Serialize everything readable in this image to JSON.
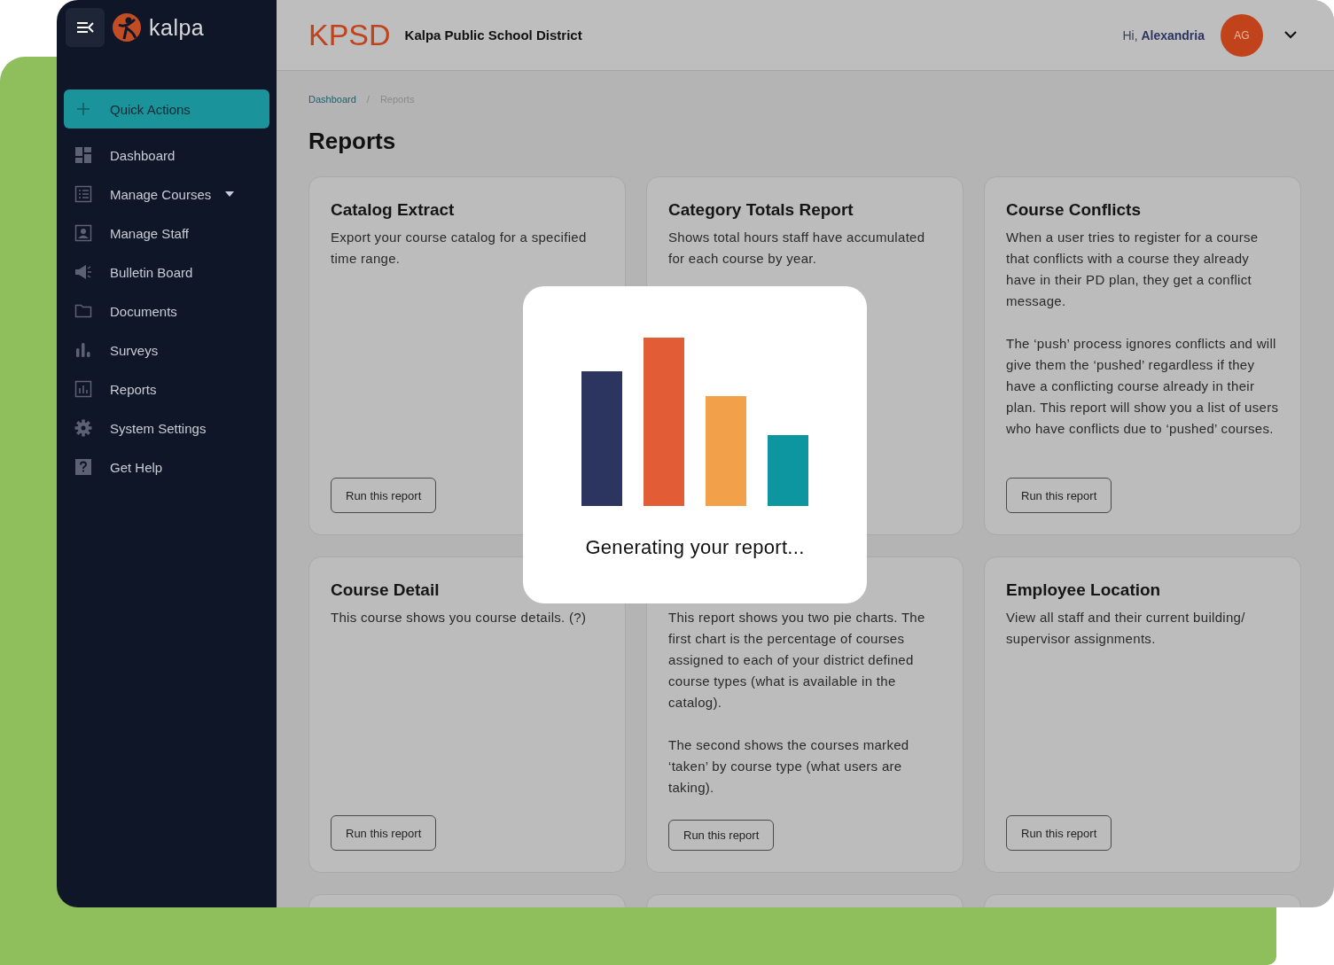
{
  "sidebar": {
    "logo": "kalpa",
    "quick_action": "Quick Actions",
    "items": [
      {
        "label": "Dashboard",
        "kind": "dashboard",
        "expandable": false
      },
      {
        "label": "Manage Courses",
        "kind": "list",
        "expandable": true
      },
      {
        "label": "Manage Staff",
        "kind": "person",
        "expandable": false
      },
      {
        "label": "Bulletin Board",
        "kind": "megaphone",
        "expandable": false
      },
      {
        "label": "Documents",
        "kind": "folder",
        "expandable": false
      },
      {
        "label": "Surveys",
        "kind": "bars",
        "expandable": false
      },
      {
        "label": "Reports",
        "kind": "report",
        "expandable": false
      },
      {
        "label": "System Settings",
        "kind": "gear",
        "expandable": false
      },
      {
        "label": "Get Help",
        "kind": "help",
        "expandable": false
      }
    ]
  },
  "header": {
    "org_short": "KPSD",
    "org_name": "Kalpa Public School District",
    "greeting": "Hi,",
    "user_name": "Alexandria",
    "avatar_initials": "AG"
  },
  "breadcrumbs": {
    "items": [
      "Dashboard",
      "Reports"
    ],
    "separator": "/"
  },
  "page_title": "Reports",
  "reports": [
    {
      "kind": "report",
      "title": "Catalog Extract",
      "description": [
        "Export your course catalog for a specified time range."
      ],
      "button": "Run this report"
    },
    {
      "kind": "report",
      "title": "Category Totals Report",
      "description": [
        "Shows total hours staff have accumulated for each course by year."
      ]
    },
    {
      "kind": "report",
      "title": "Course Conflicts",
      "description": [
        "When a user tries to register for a course that conflicts with a course they already have in their PD plan, they get a conflict message.",
        "The ‘push’ process ignores conflicts and will give them the ‘pushed’ regardless if they have a conflicting course already in their plan. This report will show you a list of users who have conflicts due to ‘pushed’ courses."
      ],
      "button": "Run this report"
    },
    {
      "kind": "report",
      "title": "Course Detail",
      "description": [
        "This course shows you course details. (?)"
      ],
      "button": "Run this report"
    },
    {
      "kind": "report",
      "description": [
        "This report shows you two pie charts. The first chart is the percentage of courses assigned to each of your district defined course types (what is available in the catalog).",
        "The second shows the courses marked ‘taken’ by course type (what users are taking)."
      ],
      "button": "Run this report"
    },
    {
      "kind": "report",
      "title": "Employee Location",
      "description": [
        "View all staff and their current building/ supervisor assignments."
      ],
      "button": "Run this report"
    },
    {
      "kind": "partial"
    },
    {
      "kind": "partial"
    },
    {
      "kind": "partial"
    }
  ],
  "modal": {
    "message": "Generating your report..."
  }
}
